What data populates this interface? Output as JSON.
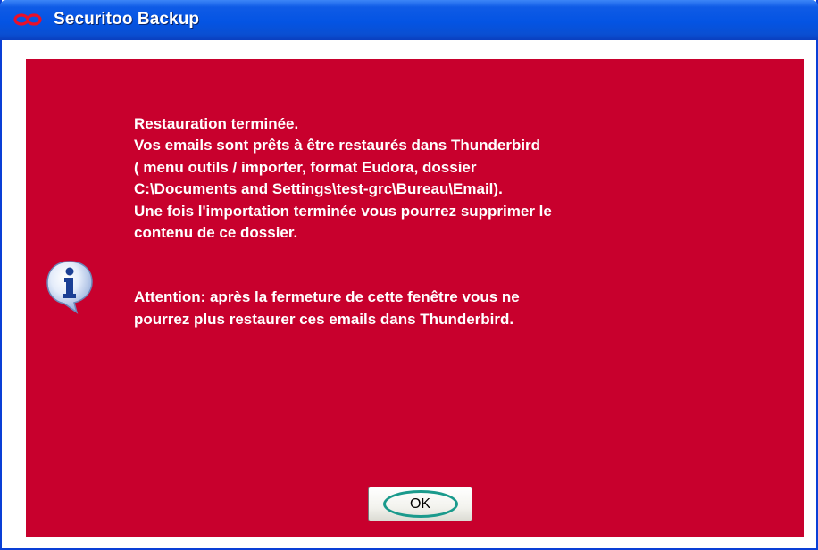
{
  "window": {
    "title": "Securitoo Backup",
    "accent_color": "#c8002d",
    "titlebar_color": "#0454e3"
  },
  "dialog": {
    "icon": "info-icon",
    "message_lines": [
      "Restauration terminée.",
      "Vos emails sont prêts à être restaurés dans Thunderbird",
      "( menu outils / importer, format Eudora, dossier",
      "C:\\Documents and Settings\\test-grc\\Bureau\\Email).",
      "Une fois l'importation terminée vous pourrez supprimer le",
      "contenu de ce dossier."
    ],
    "warning_lines": [
      "Attention: après la fermeture de cette fenêtre vous ne",
      "pourrez plus restaurer ces emails dans Thunderbird."
    ],
    "ok_label": "OK"
  }
}
